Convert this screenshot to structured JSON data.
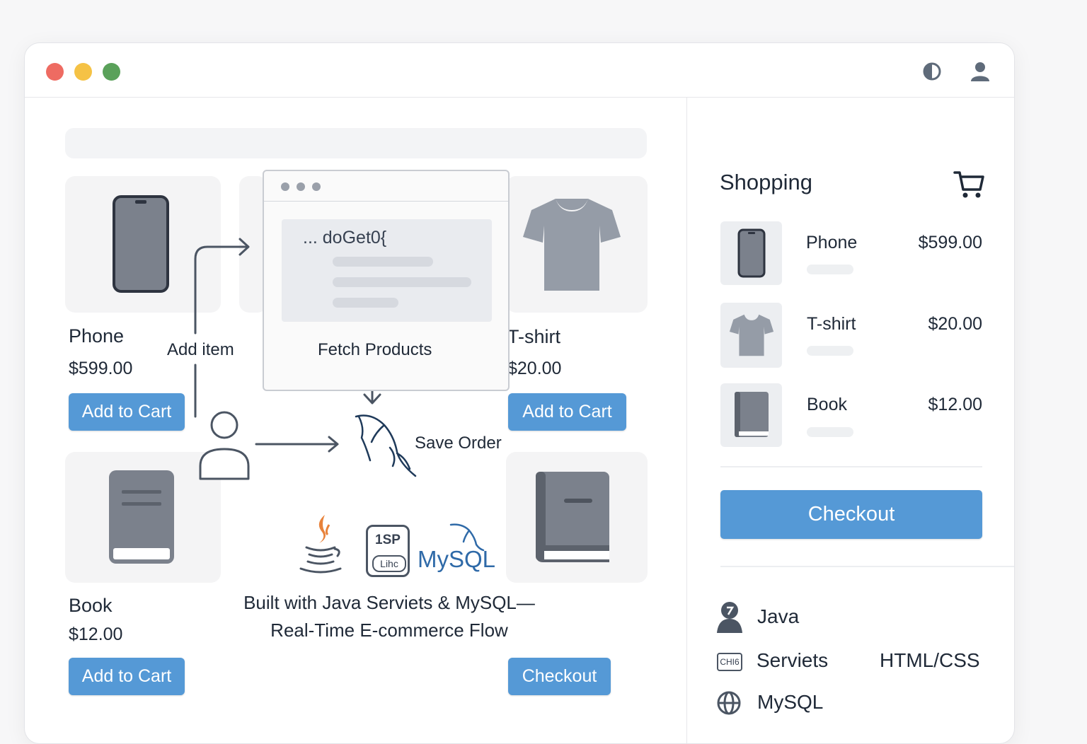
{
  "colors": {
    "accent": "#5599d6",
    "window_dot_red": "#ee6b62",
    "window_dot_yellow": "#f5c245",
    "window_dot_green": "#5aa15a"
  },
  "titlebar": {
    "icons": [
      "contrast-icon",
      "user-icon"
    ]
  },
  "products": [
    {
      "name": "Phone",
      "price": "$599.00",
      "button": "Add to Cart",
      "icon": "phone-icon"
    },
    {
      "name": "T-shirt",
      "price": "$20.00",
      "button": "Add to Cart",
      "icon": "tshirt-icon"
    },
    {
      "name": "Book",
      "price": "$12.00",
      "button": "Add to Cart",
      "icon": "book-icon"
    }
  ],
  "main": {
    "checkout_label": "Checkout"
  },
  "flow": {
    "add_item": "Add item",
    "fetch_products": "Fetch Products",
    "save_order": "Save Order",
    "code_text": "... doGet0{"
  },
  "tech_logos": {
    "jsp": "1SP",
    "jsp_sub": "Lihc",
    "mysql": "MySQL"
  },
  "caption": {
    "line1": "Built with Java Serviets & MySQL—",
    "line2": "Real-Time E-commerce Flow"
  },
  "sidebar": {
    "title": "Shopping",
    "items": [
      {
        "name": "Phone",
        "price": "$599.00"
      },
      {
        "name": "T-shirt",
        "price": "$20.00"
      },
      {
        "name": "Book",
        "price": "$12.00"
      }
    ],
    "checkout_label": "Checkout",
    "tech": [
      {
        "label": "Java",
        "icon": "java-duke-icon"
      },
      {
        "label": "Serviets",
        "icon": "servlet-chip-icon",
        "badge": "CHI6"
      },
      {
        "label": "MySQL",
        "icon": "globe-icon"
      }
    ],
    "tech_extra": "HTML/CSS"
  }
}
